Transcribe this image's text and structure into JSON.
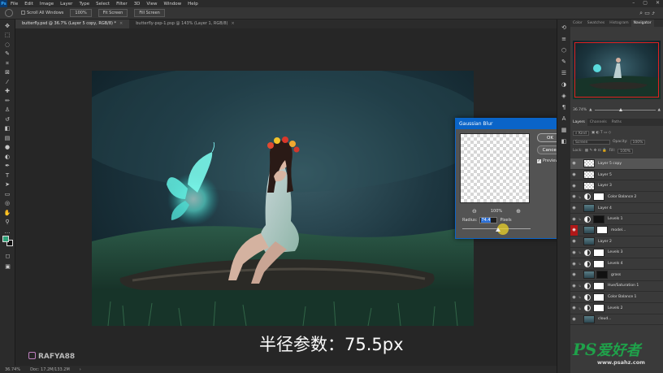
{
  "menubar": {
    "logo": "Ps",
    "items": [
      "File",
      "Edit",
      "Image",
      "Layer",
      "Type",
      "Select",
      "Filter",
      "3D",
      "View",
      "Window",
      "Help"
    ]
  },
  "optionsbar": {
    "scroll_all_windows": "Scroll All Windows",
    "zoom_value": "100%",
    "fit_screen": "Fit Screen",
    "fill_screen": "Fill Screen"
  },
  "doc_tabs": [
    {
      "label": "butterfly.psd @ 36.7% (Layer 5 copy, RGB/8) *",
      "active": true
    },
    {
      "label": "butterfly-psp-1.psp @ 143% (Layer 1, RGB/8)",
      "active": false
    }
  ],
  "subtitle": "半径参数：75.5px",
  "watermark": "RAFYA88",
  "statusbar": {
    "zoom": "36.74%",
    "doc": "Doc: 17.2M/133.2M"
  },
  "dialog": {
    "title": "Gaussian Blur",
    "ok": "OK",
    "cancel": "Cancel",
    "preview_label": "Preview",
    "zoom_percent": "100%",
    "radius_label": "Radius:",
    "radius_value": "74.4",
    "radius_unit": "Pixels",
    "slider_fraction": 0.52
  },
  "panels": {
    "top_tabs": [
      "Color",
      "Swatches",
      "Histogram",
      "Navigator"
    ],
    "active_top_tab": "Navigator",
    "nav_zoom": "36.74%",
    "layer_tabs": [
      "Layers",
      "Channels",
      "Paths"
    ],
    "kind_placeholder": "Kind",
    "blend_mode": "Screen",
    "opacity_label": "Opacity:",
    "opacity_value": "100%",
    "lock_label": "Lock:",
    "fill_label": "Fill:",
    "fill_value": "100%"
  },
  "layers": [
    {
      "name": "Layer 5 copy",
      "type": "pixel",
      "selected": true
    },
    {
      "name": "Layer 5",
      "type": "pixel"
    },
    {
      "name": "Layer 3",
      "type": "pixel"
    },
    {
      "name": "Color Balance 2",
      "type": "adjustment"
    },
    {
      "name": "Layer 4",
      "type": "photo"
    },
    {
      "name": "Levels 1",
      "type": "adjustment-mask-dark"
    },
    {
      "name": "model...",
      "type": "photo-mask",
      "eye_red": true
    },
    {
      "name": "Layer 2",
      "type": "photo"
    },
    {
      "name": "Levels 3",
      "type": "adjustment"
    },
    {
      "name": "Levels 4",
      "type": "adjustment"
    },
    {
      "name": "grass",
      "type": "photo-mask-dark"
    },
    {
      "name": "Hue/Saturation 1",
      "type": "adjustment"
    },
    {
      "name": "Color Balance 1",
      "type": "adjustment"
    },
    {
      "name": "Levels 2",
      "type": "adjustment"
    },
    {
      "name": "cloud...",
      "type": "photo"
    }
  ],
  "ps_watermark": {
    "logo": "PS",
    "cn": "爱好者",
    "site": "www.psahz.com"
  },
  "colors": {
    "accent_blue": "#0a64c8",
    "foreground_swatch": "#2fa37a",
    "eye_red": "#b01818",
    "watermark_green": "#1fa24a"
  }
}
